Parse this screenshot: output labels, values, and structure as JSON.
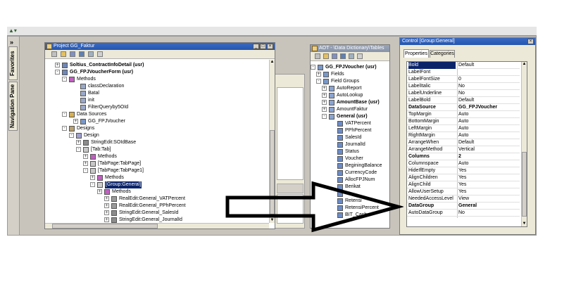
{
  "project_window": {
    "title": "Project GG_Faktur",
    "tree": [
      {
        "label": "Soltius_ContractInfoDetail (usr)",
        "bold": true,
        "icon": "form-icon",
        "expander": "+"
      },
      {
        "label": "GG_FPJVoucherForm (usr)",
        "bold": true,
        "icon": "form-icon",
        "expander": "-"
      },
      {
        "label": "Methods",
        "icon": "methods-icon",
        "expander": "-"
      },
      {
        "label": "classDeclaration",
        "icon": "method-icon",
        "expander": ""
      },
      {
        "label": "Batal",
        "icon": "method-icon",
        "expander": ""
      },
      {
        "label": "init",
        "icon": "method-icon",
        "expander": ""
      },
      {
        "label": "FilterQueryby5OId",
        "icon": "method-icon",
        "expander": ""
      },
      {
        "label": "Data Sources",
        "icon": "datasource-icon",
        "expander": "-"
      },
      {
        "label": "GG_FPJVoucher",
        "icon": "table-icon",
        "expander": "+"
      },
      {
        "label": "Designs",
        "icon": "designs-icon",
        "expander": "-"
      },
      {
        "label": "Design",
        "icon": "design-icon",
        "expander": "-"
      },
      {
        "label": "StringEdit:SOIdBase",
        "icon": "stringedit-icon",
        "expander": "+"
      },
      {
        "label": "[Tab:Tab]",
        "icon": "tab-icon",
        "expander": "-"
      },
      {
        "label": "Methods",
        "icon": "methods-icon",
        "expander": "+"
      },
      {
        "label": "[TabPage:TabPage]",
        "icon": "tabpage-icon",
        "expander": "+"
      },
      {
        "label": "[TabPage:TabPage1]",
        "icon": "tabpage-icon",
        "expander": "-"
      },
      {
        "label": "Methods",
        "icon": "methods-icon",
        "expander": "+"
      },
      {
        "label": "[Group:General]",
        "icon": "group-icon",
        "expander": "-",
        "selected": true
      },
      {
        "label": "Methods",
        "icon": "methods-icon",
        "expander": "+"
      },
      {
        "label": "RealEdit:General_VATPercent",
        "icon": "realedit-icon",
        "expander": "+"
      },
      {
        "label": "RealEdit:General_PPhPercent",
        "icon": "realedit-icon",
        "expander": "+"
      },
      {
        "label": "StringEdit:General_SalesId",
        "icon": "stringedit-icon",
        "expander": "+"
      },
      {
        "label": "StringEdit:General_JournalId",
        "icon": "stringedit-icon",
        "expander": "+"
      }
    ]
  },
  "aot_window": {
    "title": "AOT - \\Data Dictionary\\Tables",
    "tree": [
      {
        "label": "GG_FPJVoucher (usr)",
        "bold": true,
        "icon": "table-icon",
        "expander": "-"
      },
      {
        "label": "Fields",
        "icon": "fields-icon",
        "expander": "+"
      },
      {
        "label": "Field Groups",
        "icon": "fieldgroups-icon",
        "expander": "-"
      },
      {
        "label": "AutoReport",
        "icon": "fieldgroup-icon",
        "expander": "+"
      },
      {
        "label": "AutoLookup",
        "icon": "fieldgroup-icon",
        "expander": "+"
      },
      {
        "label": "AmountBase (usr)",
        "bold": true,
        "icon": "fieldgroup-icon",
        "expander": "+"
      },
      {
        "label": "AmountFaktur",
        "icon": "fieldgroup-icon",
        "expander": "+"
      },
      {
        "label": "General (usr)",
        "bold": true,
        "icon": "fieldgroup-icon",
        "expander": "-"
      },
      {
        "label": "VATPercent",
        "icon": "field-icon",
        "expander": ""
      },
      {
        "label": "PPhPercent",
        "icon": "field-icon",
        "expander": ""
      },
      {
        "label": "SalesId",
        "icon": "field-icon",
        "expander": ""
      },
      {
        "label": "JournalId",
        "icon": "field-icon",
        "expander": ""
      },
      {
        "label": "Status",
        "icon": "field-icon",
        "expander": ""
      },
      {
        "label": "Voucher",
        "icon": "field-icon",
        "expander": ""
      },
      {
        "label": "BeginingBalance",
        "icon": "field-icon",
        "expander": ""
      },
      {
        "label": "CurrencyCode",
        "icon": "field-icon",
        "expander": ""
      },
      {
        "label": "AllocFPJNum",
        "icon": "field-icon",
        "expander": ""
      },
      {
        "label": "Berikat",
        "icon": "field-icon",
        "expander": ""
      },
      {
        "label": "",
        "icon": "field-icon",
        "expander": ""
      },
      {
        "label": "Retensi",
        "icon": "field-icon",
        "expander": ""
      },
      {
        "label": "RetensiPercent",
        "icon": "field-icon",
        "expander": ""
      },
      {
        "label": "BIT_Cash",
        "icon": "field-icon",
        "expander": ""
      }
    ]
  },
  "properties_window": {
    "title": "Control [Group:General]",
    "tabs": [
      {
        "label": "Properties",
        "active": true
      },
      {
        "label": "Categories",
        "active": false
      }
    ],
    "rows": [
      {
        "name": "Bold",
        "value": "Default",
        "selected": true
      },
      {
        "name": "LabelFont",
        "value": ""
      },
      {
        "name": "LabelFontSize",
        "value": "0"
      },
      {
        "name": "LabelItalic",
        "value": "No"
      },
      {
        "name": "LabelUnderline",
        "value": "No"
      },
      {
        "name": "LabelBold",
        "value": "Default"
      },
      {
        "name": "DataSource",
        "value": "GG_FPJVoucher",
        "bold": true
      },
      {
        "name": "TopMargin",
        "value": "Auto"
      },
      {
        "name": "BottomMargin",
        "value": "Auto"
      },
      {
        "name": "LeftMargin",
        "value": "Auto"
      },
      {
        "name": "RightMargin",
        "value": "Auto"
      },
      {
        "name": "ArrangeWhen",
        "value": "Default"
      },
      {
        "name": "ArrangeMethod",
        "value": "Vertical"
      },
      {
        "name": "Columns",
        "value": "2",
        "bold": true
      },
      {
        "name": "Columnspace",
        "value": "Auto"
      },
      {
        "name": "HideIfEmpty",
        "value": "Yes"
      },
      {
        "name": "AlignChildren",
        "value": "Yes"
      },
      {
        "name": "AlignChild",
        "value": "Yes"
      },
      {
        "name": "AllowUserSetup",
        "value": "Yes"
      },
      {
        "name": "NeededAccessLevel",
        "value": "View"
      },
      {
        "name": "DataGroup",
        "value": "General",
        "bold": true
      },
      {
        "name": "AutoDataGroup",
        "value": "No"
      }
    ]
  },
  "sidebar": {
    "chevron": "»",
    "tabs": [
      "Favorites",
      "Navigation Pane"
    ]
  },
  "colors": {
    "selection": "#0a246a",
    "titlebar_active": "#2456b0",
    "titlebar_inactive": "#8893a8",
    "arrow_stroke": "#000000"
  }
}
